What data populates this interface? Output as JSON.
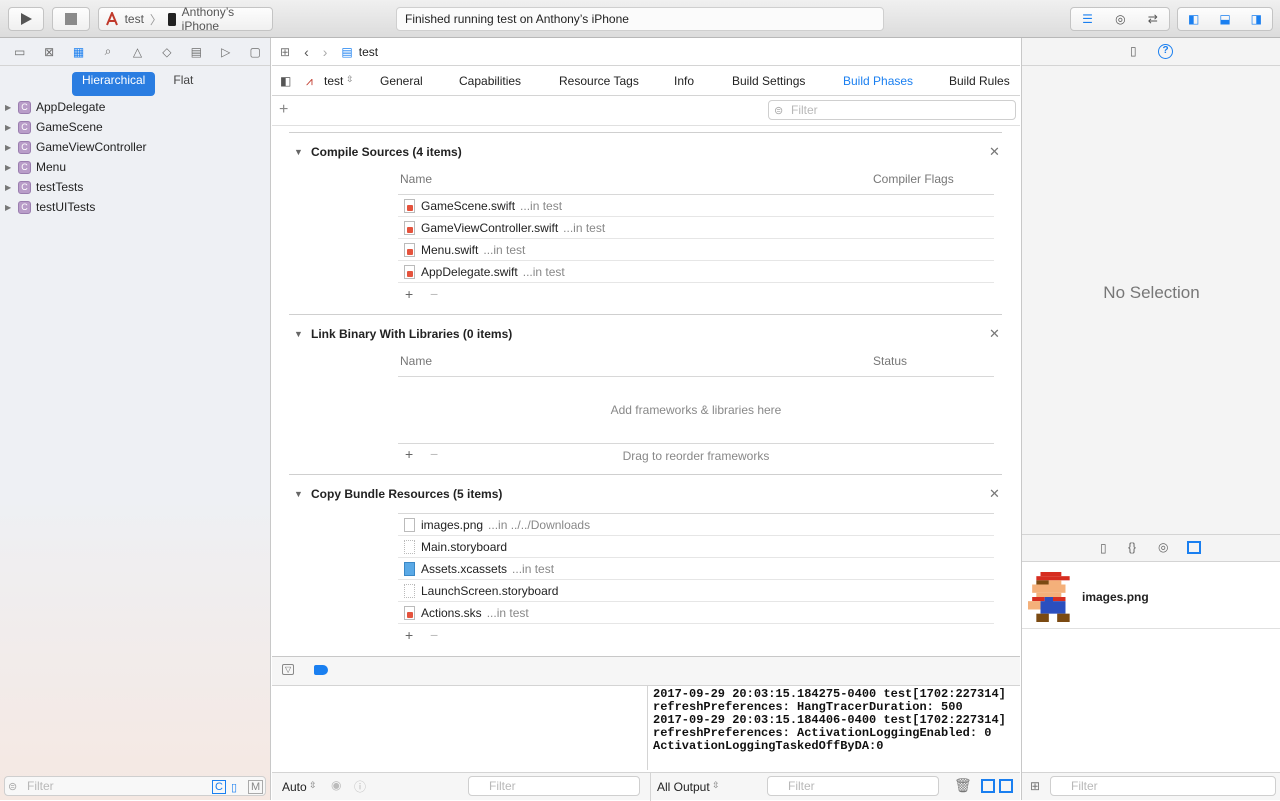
{
  "toolbar": {
    "scheme": "test",
    "device": "Anthony’s iPhone",
    "status": "Finished running test on Anthony’s iPhone"
  },
  "navigator": {
    "segments": [
      "Hierarchical",
      "Flat"
    ],
    "items": [
      "AppDelegate",
      "GameScene",
      "GameViewController",
      "Menu",
      "testTests",
      "testUITests"
    ],
    "badge": "C",
    "filter_placeholder": "Filter"
  },
  "editor": {
    "breadcrumb": "test",
    "target": "test",
    "tabs": [
      "General",
      "Capabilities",
      "Resource Tags",
      "Info",
      "Build Settings",
      "Build Phases",
      "Build Rules"
    ],
    "active_tab": "Build Phases",
    "filter_placeholder": "Filter"
  },
  "phases": {
    "compile": {
      "title": "Compile Sources (4 items)",
      "col_name": "Name",
      "col_flags": "Compiler Flags",
      "files": [
        {
          "name": "GameScene.swift",
          "path": "...in test"
        },
        {
          "name": "GameViewController.swift",
          "path": "...in test"
        },
        {
          "name": "Menu.swift",
          "path": "...in test"
        },
        {
          "name": "AppDelegate.swift",
          "path": "...in test"
        }
      ]
    },
    "link": {
      "title": "Link Binary With Libraries (0 items)",
      "col_name": "Name",
      "col_status": "Status",
      "empty_hint": "Add frameworks & libraries here",
      "drag_hint": "Drag to reorder frameworks"
    },
    "copy": {
      "title": "Copy Bundle Resources (5 items)",
      "files": [
        {
          "name": "images.png",
          "path": "...in ../../Downloads"
        },
        {
          "name": "Main.storyboard",
          "path": ""
        },
        {
          "name": "Assets.xcassets",
          "path": "...in test"
        },
        {
          "name": "LaunchScreen.storyboard",
          "path": ""
        },
        {
          "name": "Actions.sks",
          "path": "...in test"
        }
      ]
    }
  },
  "console": {
    "lines": [
      "2017-09-29 20:03:15.184275-0400 test[1702:227314]",
      "refreshPreferences: HangTracerDuration: 500",
      "2017-09-29 20:03:15.184406-0400 test[1702:227314]",
      "refreshPreferences: ActivationLoggingEnabled: 0",
      "ActivationLoggingTaskedOffByDA:0"
    ]
  },
  "debug": {
    "auto_label": "Auto",
    "output_label": "All Output",
    "filter_placeholder": "Filter"
  },
  "inspector": {
    "no_selection": "No Selection",
    "library_item": "images.png",
    "filter_placeholder": "Filter"
  },
  "colors": {
    "accent": "#2a7de1",
    "swift_icon": "#e5533d",
    "class_badge": "#b89cc8"
  }
}
